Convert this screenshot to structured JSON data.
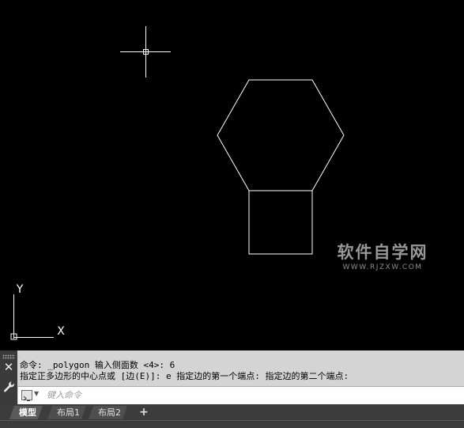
{
  "watermark": {
    "main": "软件自学网",
    "sub": "WWW.RJZXW.COM"
  },
  "ucs": {
    "x_label": "X",
    "y_label": "Y"
  },
  "command": {
    "history": [
      "命令: _polygon 输入侧面数 <4>: 6",
      "指定正多边形的中心点或 [边(E)]: e 指定边的第一个端点: 指定边的第二个端点:"
    ],
    "placeholder": "键入命令"
  },
  "tabs": [
    {
      "label": "模型",
      "active": true
    },
    {
      "label": "布局1",
      "active": false
    },
    {
      "label": "布局2",
      "active": false
    }
  ],
  "tab_add": "+",
  "colors": {
    "canvas": "#000000",
    "geometry": "#ffffff",
    "panel": "#d4d4d4"
  },
  "icons": [
    "crosshair-cursor-icon",
    "ucs-icon",
    "close-icon",
    "wrench-icon",
    "command-prompt-icon",
    "chevron-down-icon",
    "plus-icon"
  ]
}
